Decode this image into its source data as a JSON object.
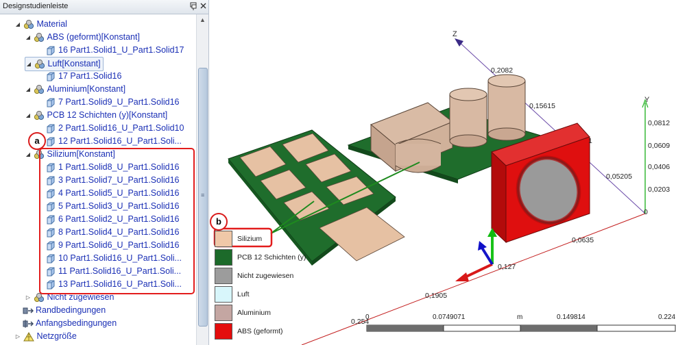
{
  "panel": {
    "title": "Designstudienleiste",
    "pin_icon": "pin-icon",
    "close_icon": "close-icon"
  },
  "tree": [
    {
      "id": "material",
      "label": "Material",
      "level": 1,
      "arrow": "expanded",
      "icon": "material-icon"
    },
    {
      "id": "abs",
      "label": "ABS (geformt)[Konstant]",
      "level": 2,
      "arrow": "expanded",
      "icon": "material-icon"
    },
    {
      "id": "abs-16",
      "label": "16 Part1.Solid1_U_Part1.Solid17",
      "level": 3,
      "arrow": "none",
      "icon": "solid-icon"
    },
    {
      "id": "luft",
      "label": "Luft[Konstant]",
      "level": 2,
      "arrow": "expanded",
      "icon": "material-icon",
      "selected": true
    },
    {
      "id": "luft-17",
      "label": "17 Part1.Solid16",
      "level": 3,
      "arrow": "none",
      "icon": "solid-icon"
    },
    {
      "id": "alu",
      "label": "Aluminium[Konstant]",
      "level": 2,
      "arrow": "expanded",
      "icon": "material-icon"
    },
    {
      "id": "alu-7",
      "label": "7 Part1.Solid9_U_Part1.Solid16",
      "level": 3,
      "arrow": "none",
      "icon": "solid-icon"
    },
    {
      "id": "pcb",
      "label": "PCB 12 Schichten (y)[Konstant]",
      "level": 2,
      "arrow": "expanded",
      "icon": "material-icon"
    },
    {
      "id": "pcb-2",
      "label": "2 Part1.Solid16_U_Part1.Solid10",
      "level": 3,
      "arrow": "none",
      "icon": "solid-icon"
    },
    {
      "id": "pcb-12",
      "label": "12 Part1.Solid16_U_Part1.Soli...",
      "level": 3,
      "arrow": "none",
      "icon": "solid-icon"
    },
    {
      "id": "si",
      "label": "Silizium[Konstant]",
      "level": 2,
      "arrow": "expanded",
      "icon": "material-icon"
    },
    {
      "id": "si-1",
      "label": "1 Part1.Solid8_U_Part1.Solid16",
      "level": 3,
      "arrow": "none",
      "icon": "solid-icon"
    },
    {
      "id": "si-3",
      "label": "3 Part1.Solid7_U_Part1.Solid16",
      "level": 3,
      "arrow": "none",
      "icon": "solid-icon"
    },
    {
      "id": "si-4",
      "label": "4 Part1.Solid5_U_Part1.Solid16",
      "level": 3,
      "arrow": "none",
      "icon": "solid-icon"
    },
    {
      "id": "si-5",
      "label": "5 Part1.Solid3_U_Part1.Solid16",
      "level": 3,
      "arrow": "none",
      "icon": "solid-icon"
    },
    {
      "id": "si-6",
      "label": "6 Part1.Solid2_U_Part1.Solid16",
      "level": 3,
      "arrow": "none",
      "icon": "solid-icon"
    },
    {
      "id": "si-8",
      "label": "8 Part1.Solid4_U_Part1.Solid16",
      "level": 3,
      "arrow": "none",
      "icon": "solid-icon"
    },
    {
      "id": "si-9",
      "label": "9 Part1.Solid6_U_Part1.Solid16",
      "level": 3,
      "arrow": "none",
      "icon": "solid-icon"
    },
    {
      "id": "si-10",
      "label": "10 Part1.Solid16_U_Part1.Soli...",
      "level": 3,
      "arrow": "none",
      "icon": "solid-icon"
    },
    {
      "id": "si-11",
      "label": "11 Part1.Solid16_U_Part1.Soli...",
      "level": 3,
      "arrow": "none",
      "icon": "solid-icon"
    },
    {
      "id": "si-13",
      "label": "13 Part1.Solid16_U_Part1.Soli...",
      "level": 3,
      "arrow": "none",
      "icon": "solid-icon"
    },
    {
      "id": "nz",
      "label": "Nicht zugewiesen",
      "level": 2,
      "arrow": "collapsed",
      "icon": "material-icon"
    },
    {
      "id": "rand",
      "label": "Randbedingungen",
      "level": 1,
      "arrow": "none",
      "icon": "boundary-conditions-icon"
    },
    {
      "id": "anfang",
      "label": "Anfangsbedingungen",
      "level": 1,
      "arrow": "none",
      "icon": "initial-conditions-icon"
    },
    {
      "id": "netz",
      "label": "Netzgröße",
      "level": 1,
      "arrow": "collapsed",
      "icon": "mesh-size-icon"
    }
  ],
  "callouts": {
    "a": "a",
    "b": "b"
  },
  "legend": [
    {
      "label": "Silizium",
      "color": "#f0c8a8"
    },
    {
      "label": "PCB 12 Schichten (y)",
      "color": "#1c6a2a"
    },
    {
      "label": "Nicht zugewiesen",
      "color": "#9c9c9c"
    },
    {
      "label": "Luft",
      "color": "#d8f6fb"
    },
    {
      "label": "Aluminium",
      "color": "#c4a6a2"
    },
    {
      "label": "ABS (geformt)",
      "color": "#e40d0d"
    }
  ],
  "axes": {
    "z_label": "Z",
    "y_label": "Y",
    "z_ticks": [
      "0,2082",
      "0,15615",
      "1",
      "0,05205"
    ],
    "y_ticks": [
      "0,0812",
      "0,0609",
      "0,0406",
      "0,0203",
      "0"
    ],
    "x_ticks": [
      "0,0635",
      "0,127",
      "0,1905",
      "0,254"
    ]
  },
  "scale": {
    "unit": "m",
    "labels": [
      "0",
      "0.0749071",
      "0.149814",
      "0.224"
    ]
  },
  "colors": {
    "silicon": "#e8c3a6",
    "pcb": "#1d6b2b",
    "aluminium": "#d4b8a6",
    "abs": "#e40d0d",
    "triad_z": "#11bb11",
    "triad_x": "#d81818",
    "triad_y": "#1010c8"
  }
}
